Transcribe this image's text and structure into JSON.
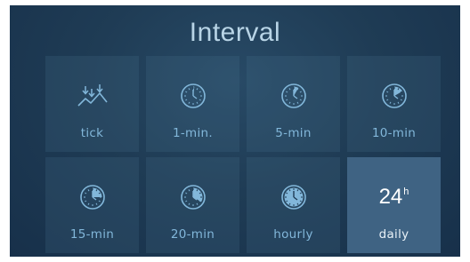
{
  "title": "Interval",
  "selected_index": 7,
  "colors": {
    "accent": "#82b7da",
    "selected_tile": "#3f6383",
    "background": "#1f3c55"
  },
  "items": [
    {
      "label": "tick",
      "icon": "tick-chart-icon"
    },
    {
      "label": "1-min.",
      "icon": "clock-1-min-icon",
      "fill_fraction": 0.02
    },
    {
      "label": "5-min",
      "icon": "clock-5-min-icon",
      "fill_fraction": 0.083
    },
    {
      "label": "10-min",
      "icon": "clock-10-min-icon",
      "fill_fraction": 0.167
    },
    {
      "label": "15-min",
      "icon": "clock-15-min-icon",
      "fill_fraction": 0.25
    },
    {
      "label": "20-min",
      "icon": "clock-20-min-icon",
      "fill_fraction": 0.333
    },
    {
      "label": "hourly",
      "icon": "clock-hourly-icon",
      "fill_fraction": 1.0
    },
    {
      "label": "daily",
      "icon": "daily-24h-icon",
      "big": "24",
      "sup": "h"
    }
  ]
}
